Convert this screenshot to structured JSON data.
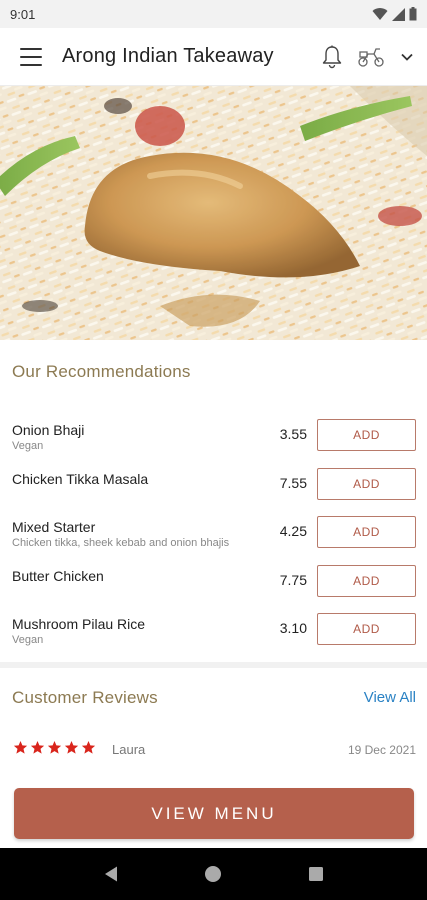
{
  "status_bar": {
    "time": "9:01"
  },
  "app_bar": {
    "title": "Arong Indian Takeaway"
  },
  "hero": {
    "image": "chicken-biryani-photo"
  },
  "recommendations": {
    "title": "Our Recommendations",
    "items": [
      {
        "name": "Onion Bhaji",
        "description": "Vegan",
        "price": "3.55",
        "button": "ADD"
      },
      {
        "name": "Chicken Tikka Masala",
        "description": "",
        "price": "7.55",
        "button": "ADD"
      },
      {
        "name": "Mixed Starter",
        "description": "Chicken tikka, sheek kebab and onion bhajis",
        "price": "4.25",
        "button": "ADD"
      },
      {
        "name": "Butter Chicken",
        "description": "",
        "price": "7.75",
        "button": "ADD"
      },
      {
        "name": "Mushroom Pilau Rice",
        "description": "Vegan",
        "price": "3.10",
        "button": "ADD"
      }
    ]
  },
  "reviews": {
    "title": "Customer Reviews",
    "view_all": "View All",
    "items": [
      {
        "rating": 5,
        "reviewer": "Laura",
        "date": "19 Dec 2021"
      }
    ]
  },
  "cta": {
    "label": "VIEW MENU"
  },
  "colors": {
    "accent": "#b5604c",
    "section_title": "#8c7a52",
    "link": "#2a82c4",
    "star": "#d9251c"
  }
}
